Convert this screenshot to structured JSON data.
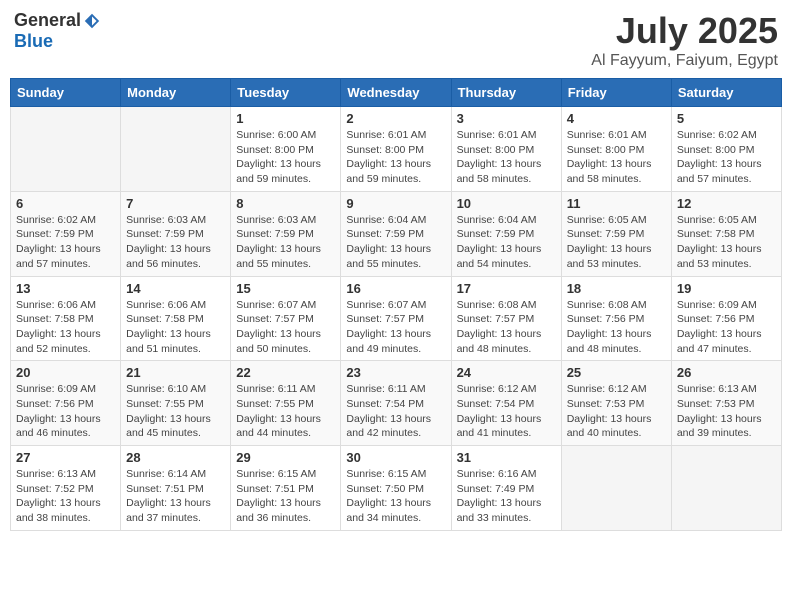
{
  "header": {
    "logo_general": "General",
    "logo_blue": "Blue",
    "month_title": "July 2025",
    "location": "Al Fayyum, Faiyum, Egypt"
  },
  "days_of_week": [
    "Sunday",
    "Monday",
    "Tuesday",
    "Wednesday",
    "Thursday",
    "Friday",
    "Saturday"
  ],
  "weeks": [
    [
      {
        "day": "",
        "info": ""
      },
      {
        "day": "",
        "info": ""
      },
      {
        "day": "1",
        "info": "Sunrise: 6:00 AM\nSunset: 8:00 PM\nDaylight: 13 hours and 59 minutes."
      },
      {
        "day": "2",
        "info": "Sunrise: 6:01 AM\nSunset: 8:00 PM\nDaylight: 13 hours and 59 minutes."
      },
      {
        "day": "3",
        "info": "Sunrise: 6:01 AM\nSunset: 8:00 PM\nDaylight: 13 hours and 58 minutes."
      },
      {
        "day": "4",
        "info": "Sunrise: 6:01 AM\nSunset: 8:00 PM\nDaylight: 13 hours and 58 minutes."
      },
      {
        "day": "5",
        "info": "Sunrise: 6:02 AM\nSunset: 8:00 PM\nDaylight: 13 hours and 57 minutes."
      }
    ],
    [
      {
        "day": "6",
        "info": "Sunrise: 6:02 AM\nSunset: 7:59 PM\nDaylight: 13 hours and 57 minutes."
      },
      {
        "day": "7",
        "info": "Sunrise: 6:03 AM\nSunset: 7:59 PM\nDaylight: 13 hours and 56 minutes."
      },
      {
        "day": "8",
        "info": "Sunrise: 6:03 AM\nSunset: 7:59 PM\nDaylight: 13 hours and 55 minutes."
      },
      {
        "day": "9",
        "info": "Sunrise: 6:04 AM\nSunset: 7:59 PM\nDaylight: 13 hours and 55 minutes."
      },
      {
        "day": "10",
        "info": "Sunrise: 6:04 AM\nSunset: 7:59 PM\nDaylight: 13 hours and 54 minutes."
      },
      {
        "day": "11",
        "info": "Sunrise: 6:05 AM\nSunset: 7:59 PM\nDaylight: 13 hours and 53 minutes."
      },
      {
        "day": "12",
        "info": "Sunrise: 6:05 AM\nSunset: 7:58 PM\nDaylight: 13 hours and 53 minutes."
      }
    ],
    [
      {
        "day": "13",
        "info": "Sunrise: 6:06 AM\nSunset: 7:58 PM\nDaylight: 13 hours and 52 minutes."
      },
      {
        "day": "14",
        "info": "Sunrise: 6:06 AM\nSunset: 7:58 PM\nDaylight: 13 hours and 51 minutes."
      },
      {
        "day": "15",
        "info": "Sunrise: 6:07 AM\nSunset: 7:57 PM\nDaylight: 13 hours and 50 minutes."
      },
      {
        "day": "16",
        "info": "Sunrise: 6:07 AM\nSunset: 7:57 PM\nDaylight: 13 hours and 49 minutes."
      },
      {
        "day": "17",
        "info": "Sunrise: 6:08 AM\nSunset: 7:57 PM\nDaylight: 13 hours and 48 minutes."
      },
      {
        "day": "18",
        "info": "Sunrise: 6:08 AM\nSunset: 7:56 PM\nDaylight: 13 hours and 48 minutes."
      },
      {
        "day": "19",
        "info": "Sunrise: 6:09 AM\nSunset: 7:56 PM\nDaylight: 13 hours and 47 minutes."
      }
    ],
    [
      {
        "day": "20",
        "info": "Sunrise: 6:09 AM\nSunset: 7:56 PM\nDaylight: 13 hours and 46 minutes."
      },
      {
        "day": "21",
        "info": "Sunrise: 6:10 AM\nSunset: 7:55 PM\nDaylight: 13 hours and 45 minutes."
      },
      {
        "day": "22",
        "info": "Sunrise: 6:11 AM\nSunset: 7:55 PM\nDaylight: 13 hours and 44 minutes."
      },
      {
        "day": "23",
        "info": "Sunrise: 6:11 AM\nSunset: 7:54 PM\nDaylight: 13 hours and 42 minutes."
      },
      {
        "day": "24",
        "info": "Sunrise: 6:12 AM\nSunset: 7:54 PM\nDaylight: 13 hours and 41 minutes."
      },
      {
        "day": "25",
        "info": "Sunrise: 6:12 AM\nSunset: 7:53 PM\nDaylight: 13 hours and 40 minutes."
      },
      {
        "day": "26",
        "info": "Sunrise: 6:13 AM\nSunset: 7:53 PM\nDaylight: 13 hours and 39 minutes."
      }
    ],
    [
      {
        "day": "27",
        "info": "Sunrise: 6:13 AM\nSunset: 7:52 PM\nDaylight: 13 hours and 38 minutes."
      },
      {
        "day": "28",
        "info": "Sunrise: 6:14 AM\nSunset: 7:51 PM\nDaylight: 13 hours and 37 minutes."
      },
      {
        "day": "29",
        "info": "Sunrise: 6:15 AM\nSunset: 7:51 PM\nDaylight: 13 hours and 36 minutes."
      },
      {
        "day": "30",
        "info": "Sunrise: 6:15 AM\nSunset: 7:50 PM\nDaylight: 13 hours and 34 minutes."
      },
      {
        "day": "31",
        "info": "Sunrise: 6:16 AM\nSunset: 7:49 PM\nDaylight: 13 hours and 33 minutes."
      },
      {
        "day": "",
        "info": ""
      },
      {
        "day": "",
        "info": ""
      }
    ]
  ]
}
